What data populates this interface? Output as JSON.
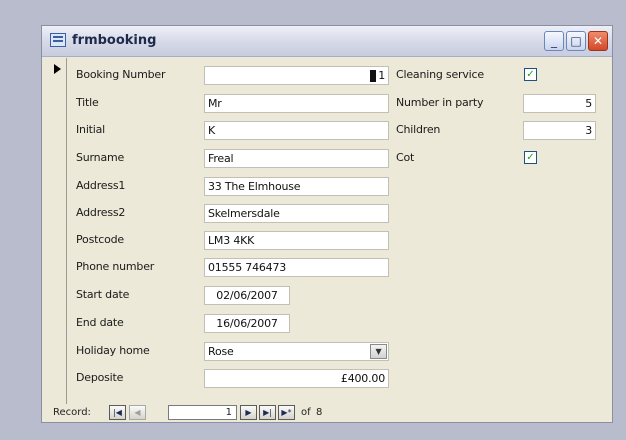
{
  "window": {
    "title": "frmbooking",
    "controls": [
      "minimize",
      "maximize",
      "close"
    ],
    "control_glyphs": {
      "minimize": "_",
      "maximize": "□",
      "close": "✕"
    }
  },
  "record_selector": "▶",
  "fields_left": [
    {
      "label": "Booking Number",
      "value": "1",
      "align": "right",
      "cursor": true
    },
    {
      "label": "Title",
      "value": "Mr"
    },
    {
      "label": "Initial",
      "value": "K"
    },
    {
      "label": "Surname",
      "value": "Freal"
    },
    {
      "label": "Address1",
      "value": "33 The Elmhouse"
    },
    {
      "label": "Address2",
      "value": "Skelmersdale"
    },
    {
      "label": "Postcode",
      "value": "LM3 4KK"
    },
    {
      "label": "Phone number",
      "value": "01555 746473"
    },
    {
      "label": "Start date",
      "value": "02/06/2007"
    },
    {
      "label": "End date",
      "value": "16/06/2007"
    },
    {
      "label": "Holiday home",
      "value": "Rose",
      "type": "combo"
    },
    {
      "label": "Deposite",
      "value": "£400.00",
      "align": "right"
    }
  ],
  "fields_right": [
    {
      "label": "Cleaning service",
      "type": "checkbox",
      "checked": true
    },
    {
      "label": "Number in party",
      "value": "5"
    },
    {
      "label": "Children",
      "value": "3"
    },
    {
      "label": "Cot",
      "type": "checkbox",
      "checked": true
    }
  ],
  "navigation": {
    "label": "Record:",
    "current": "1",
    "of_label": "of",
    "total": "8",
    "buttons": {
      "first": "|◀",
      "prev": "◀",
      "next": "▶",
      "last": "▶|",
      "new": "▶*"
    }
  },
  "glyphs": {
    "check": "✓",
    "combo_arrow": "▼"
  }
}
